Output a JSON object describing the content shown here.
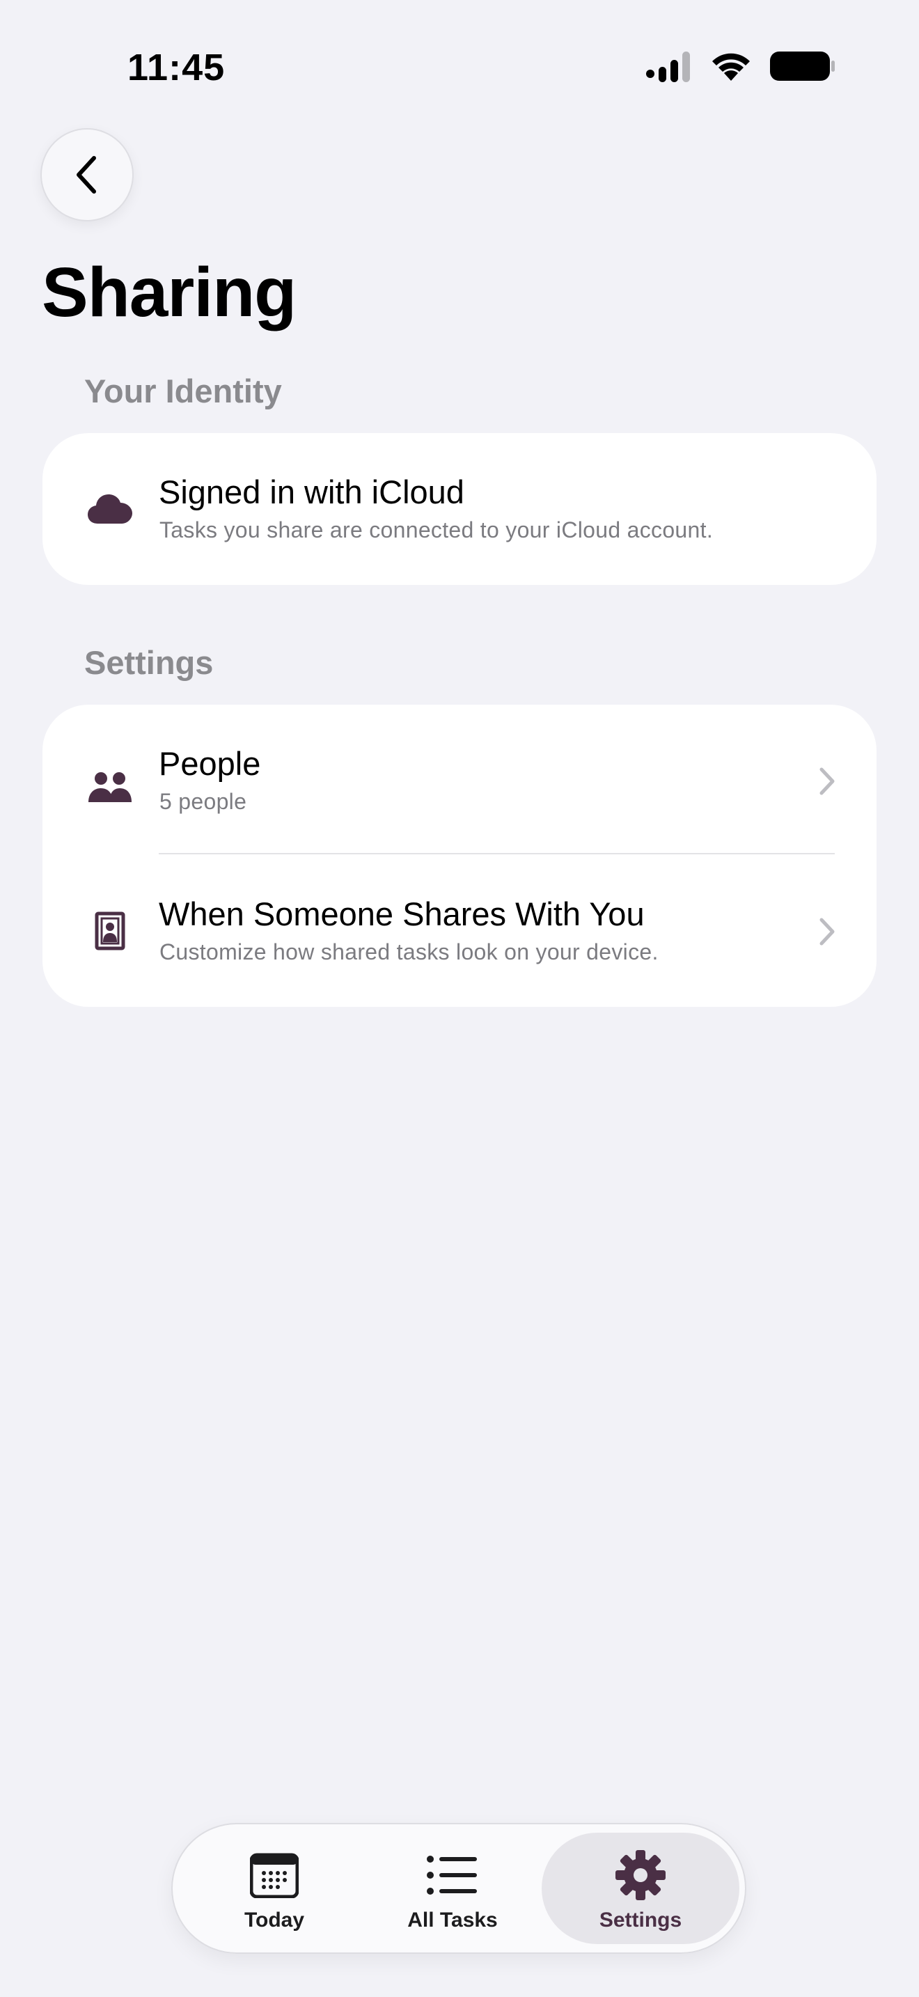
{
  "status_bar": {
    "time": "11:45"
  },
  "header": {
    "back_icon": "chevron-left-icon",
    "title": "Sharing"
  },
  "sections": {
    "identity": {
      "header": "Your Identity",
      "row": {
        "icon": "cloud-icon",
        "title": "Signed in with iCloud",
        "subtitle": "Tasks you share are connected to your iCloud account."
      }
    },
    "settings": {
      "header": "Settings",
      "rows": [
        {
          "icon": "people-icon",
          "title": "People",
          "subtitle": "5 people"
        },
        {
          "icon": "contact-card-icon",
          "title": "When Someone Shares With You",
          "subtitle": "Customize how shared tasks look on your device."
        }
      ]
    }
  },
  "tab_bar": {
    "tabs": [
      {
        "label": "Today",
        "icon": "calendar-icon",
        "active": false
      },
      {
        "label": "All Tasks",
        "icon": "list-icon",
        "active": false
      },
      {
        "label": "Settings",
        "icon": "gear-icon",
        "active": true
      }
    ]
  },
  "colors": {
    "background": "#F2F2F7",
    "card": "#FFFFFF",
    "accent": "#4A2F45",
    "secondary_text": "#8A8A8E"
  }
}
